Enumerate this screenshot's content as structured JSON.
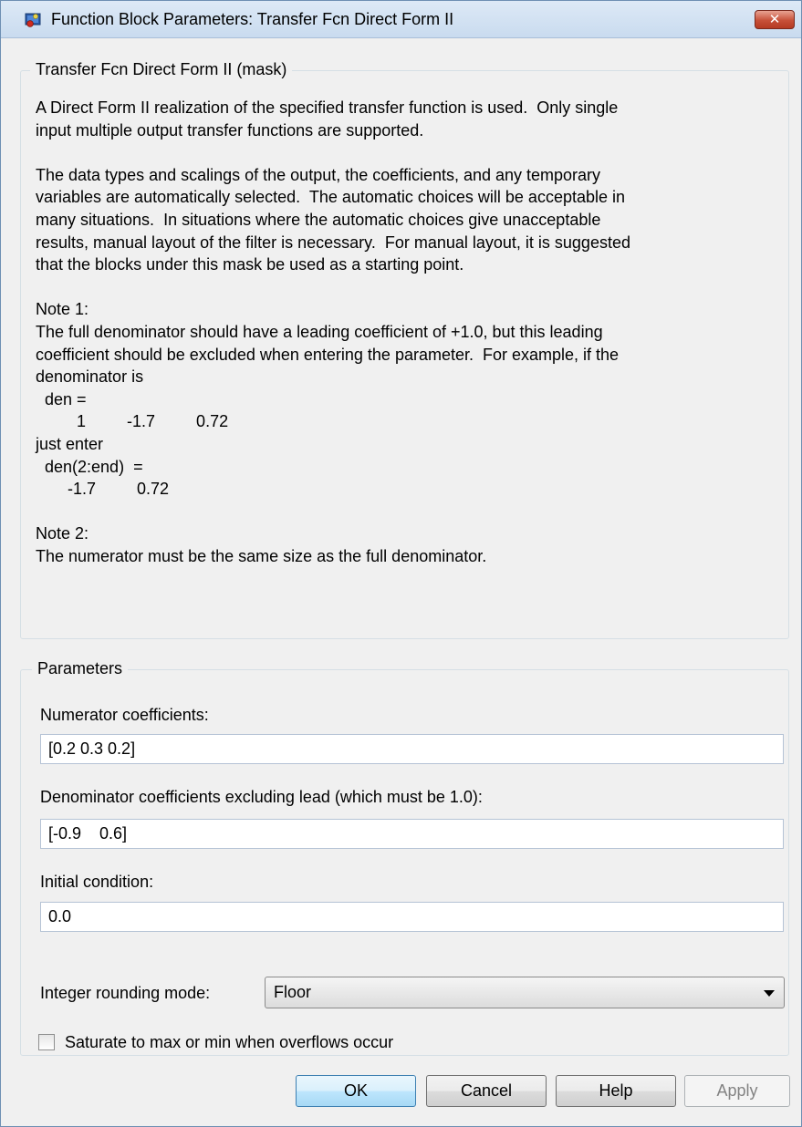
{
  "window": {
    "title": "Function Block Parameters: Transfer Fcn Direct Form II",
    "close_glyph": "✕"
  },
  "mask": {
    "legend": "Transfer Fcn Direct Form II (mask)",
    "description": "A Direct Form II realization of the specified transfer function is used.  Only single\ninput multiple output transfer functions are supported.\n\nThe data types and scalings of the output, the coefficients, and any temporary\nvariables are automatically selected.  The automatic choices will be acceptable in\nmany situations.  In situations where the automatic choices give unacceptable\nresults, manual layout of the filter is necessary.  For manual layout, it is suggested\nthat the blocks under this mask be used as a starting point.\n\nNote 1:\nThe full denominator should have a leading coefficient of +1.0, but this leading\ncoefficient should be excluded when entering the parameter.  For example, if the\ndenominator is\n  den =\n         1         -1.7         0.72\njust enter\n  den(2:end)  =\n       -1.7         0.72\n\nNote 2:\nThe numerator must be the same size as the full denominator."
  },
  "parameters": {
    "legend": "Parameters",
    "numerator_label": "Numerator coefficients:",
    "numerator_value": "[0.2 0.3 0.2]",
    "denominator_label": "Denominator coefficients excluding lead (which must be 1.0):",
    "denominator_value": "[-0.9    0.6]",
    "initial_label": "Initial condition:",
    "initial_value": "0.0",
    "rounding_label": "Integer rounding mode:",
    "rounding_value": "Floor",
    "saturate_label": "Saturate to max or min when overflows occur",
    "saturate_checked": false
  },
  "buttons": {
    "ok": "OK",
    "cancel": "Cancel",
    "help": "Help",
    "apply": "Apply"
  },
  "colors": {
    "title_bar": "#c9dbef",
    "close_button": "#c75039",
    "dialog_bg": "#f0f0f0"
  },
  "icons": [
    "simulink-app-icon",
    "close-icon",
    "chevron-down-icon",
    "checkbox-icon"
  ]
}
